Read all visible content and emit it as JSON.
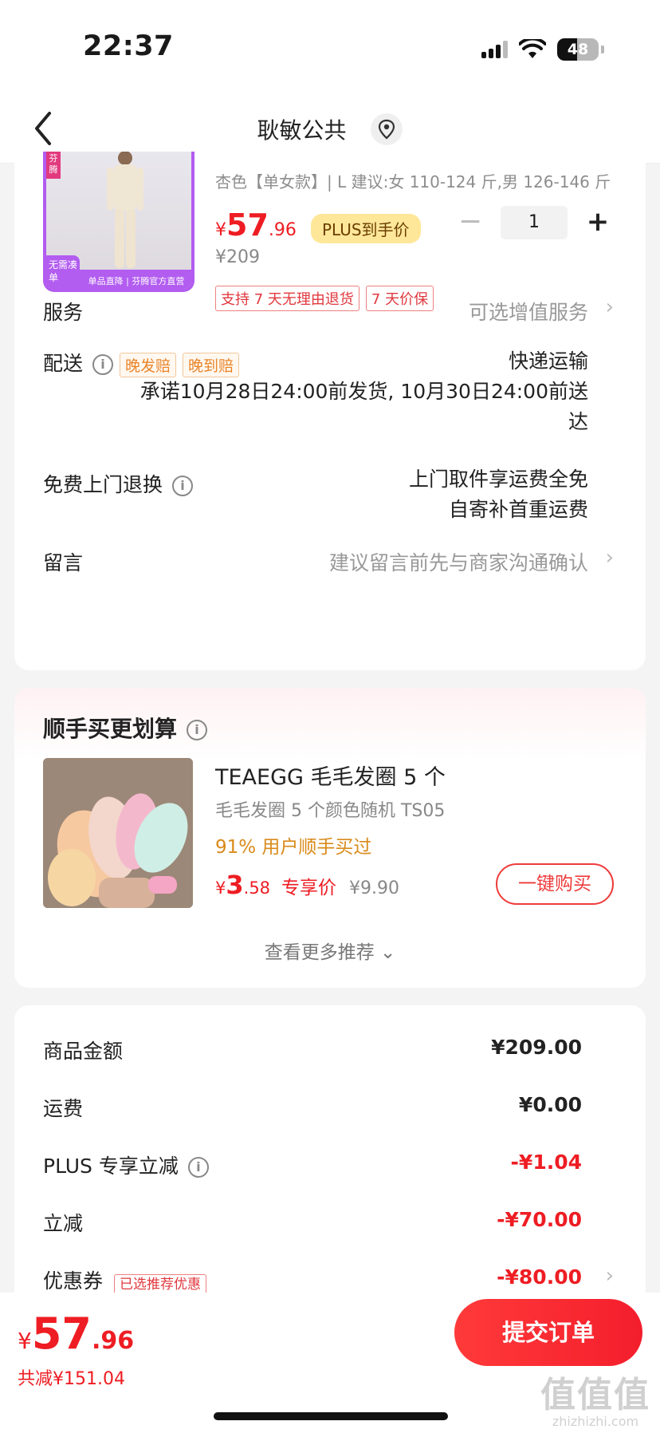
{
  "status": {
    "time": "22:37",
    "battery": "48",
    "battery_level": 0.48
  },
  "nav": {
    "title": "耿敏公共"
  },
  "product": {
    "corner_tag": "芬腾",
    "badge_left": "无需凑单",
    "badge_strip": "单品直降 | 芬腾官方直营",
    "spec": "杏色【单女款】| L 建议:女 110-124 斤,男 126-146 斤",
    "price_yen": "¥",
    "price_int": "57",
    "price_dec": ".96",
    "plus_tag": "PLUS到手价",
    "orig_price": "¥209",
    "tags": [
      "支持 7 天无理由退货",
      "7 天价保"
    ],
    "qty_minus": "−",
    "quantity": "1",
    "qty_plus": "+"
  },
  "rows": {
    "service": {
      "label": "服务",
      "value": "可选增值服务"
    },
    "delivery": {
      "label": "配送",
      "tag1": "晚发赔",
      "tag2": "晚到赔",
      "method": "快递运输",
      "promise_line1": "承诺10月28日24:00前发货, 10月30日24:00前送",
      "promise_line2": "达"
    },
    "returns": {
      "label": "免费上门退换",
      "line1": "上门取件享运费全免",
      "line2": "自寄补首重运费"
    },
    "message": {
      "label": "留言",
      "value": "建议留言前先与商家沟通确认"
    }
  },
  "recommend": {
    "title": "顺手买更划算",
    "img_sticker": "毛毛发圈",
    "name": "TEAEGG 毛毛发圈 5 个",
    "sub": "毛毛发圈 5 个颜色随机 TS05",
    "rate": "91% 用户顺手买过",
    "price_yen": "¥",
    "price_int": "3",
    "price_dec": ".58",
    "price_label": "专享价",
    "orig": "¥9.90",
    "buy_button": "一键购买",
    "more": "查看更多推荐 ⌄"
  },
  "summary": {
    "goods": {
      "label": "商品金额",
      "value": "¥209.00"
    },
    "shipping": {
      "label": "运费",
      "value": "¥0.00"
    },
    "plus": {
      "label": "PLUS 专享立减",
      "value": "-¥1.04"
    },
    "discount": {
      "label": "立减",
      "value": "-¥70.00"
    },
    "coupon": {
      "label": "优惠券",
      "tag": "已选推荐优惠",
      "value": "-¥80.00"
    }
  },
  "bottom": {
    "total_yen": "¥",
    "total_int": "57",
    "total_dec": ".96",
    "saving": "共减¥151.04",
    "submit": "提交订单"
  },
  "watermark": {
    "big": "值值值",
    "small": "zhizhizhi.com"
  },
  "colors": {
    "accent_red": "#ee1d23",
    "plus_gold": "#ffe79a",
    "rate_orange": "#d98a1a"
  },
  "icons": [
    "signal-icon",
    "wifi-icon",
    "battery-icon",
    "back-arrow-icon",
    "location-icon",
    "info-icon",
    "chevron-right-icon"
  ]
}
